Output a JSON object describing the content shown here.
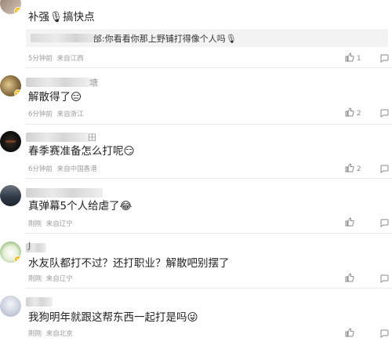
{
  "comments": [
    {
      "text": "补强🎙搞快点",
      "quote": {
        "text": "邰:你看看你那上野铺打得像个人吗🎙"
      },
      "time": "5分钟前",
      "location": "来自江西",
      "likes": "1",
      "avatar_colors": [
        "#8d7b6e",
        "#d8c7b8"
      ]
    },
    {
      "username_tail": "塘",
      "text": "解散得了😑",
      "time": "6分钟前",
      "location": "来自浙江",
      "likes": "2",
      "avatar_colors": [
        "#b59a6a",
        "#5e4b31"
      ]
    },
    {
      "username_tail": "田",
      "text": "春季赛准备怎么打呢😏",
      "time": "6分钟前",
      "location": "来自中国香港",
      "likes": "2",
      "avatar_colors": [
        "#151515",
        "#3a2a20"
      ]
    },
    {
      "text": "真弹幕5个人给虐了😂",
      "time": "刚刚",
      "location": "来自辽宁",
      "likes": "",
      "avatar_colors": [
        "#2f3a47",
        "#8a8f96"
      ]
    },
    {
      "username_tail": "J",
      "text": "水友队都打不过？还打职业？解散吧别摆了",
      "time": "刚刚",
      "location": "来自辽宁",
      "likes": "",
      "avatar_colors": [
        "#6fa35a",
        "#d8e8c8"
      ]
    },
    {
      "text": "我狗明年就跟这帮东西一起打是吗😜",
      "time": "刚刚",
      "location": "来自北京",
      "likes": "",
      "avatar_colors": [
        "#c0c6d6",
        "#e8ecf3"
      ]
    }
  ]
}
